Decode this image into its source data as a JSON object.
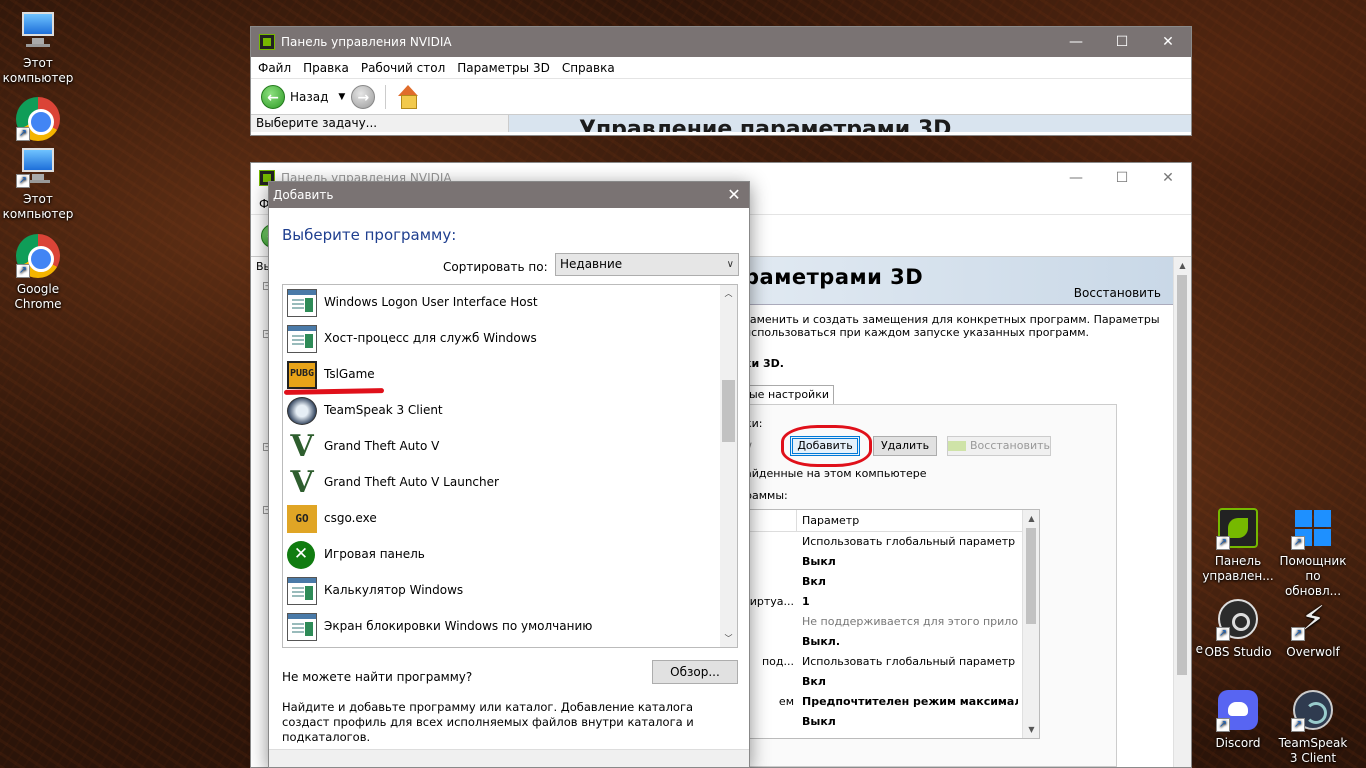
{
  "desktop": {
    "left_icons": [
      {
        "label": "Этот компьютер",
        "icon": "this-pc-icon"
      },
      {
        "label": "",
        "icon": "chrome-icon"
      },
      {
        "label": "Этот компьютер",
        "icon": "this-pc-icon"
      },
      {
        "label": "Google Chrome",
        "icon": "chrome-icon"
      }
    ],
    "right_icons": [
      {
        "label": "Панель управлен...",
        "icon": "nvidia-control-panel-icon"
      },
      {
        "label": "Помощник по обновл...",
        "icon": "windows-update-assistant-icon"
      },
      {
        "label": "OBS Studio",
        "icon": "obs-studio-icon"
      },
      {
        "label": "Overwolf",
        "icon": "overwolf-icon"
      },
      {
        "label": "Discord",
        "icon": "discord-icon"
      },
      {
        "label": "TeamSpeak 3 Client",
        "icon": "teamspeak-icon"
      }
    ],
    "edge_fragment": "e"
  },
  "nvidia_window_top": {
    "title": "Панель управления NVIDIA",
    "menu": [
      "Файл",
      "Правка",
      "Рабочий стол",
      "Параметры 3D",
      "Справка"
    ],
    "back_label": "Назад",
    "task_prompt": "Выберите задачу...",
    "page_title_fragment": "Управление параметрами 3D"
  },
  "nvidia_window_second": {
    "title": "Панель управления NVIDIA",
    "menu_fragment": "Ф",
    "left_fragment": "Вы",
    "banner_title_fragment": "раметрами 3D",
    "restore_link": "Восстановить",
    "description_fragment": "заменить и создать замещения для конкретных программ. Параметры использоваться при каждом запуске указанных программ.",
    "section_fragment": "ки 3D.",
    "tab_fragment": "ые настройки",
    "select_label_fragment": "ки:",
    "add_button": "Добавить",
    "remove_button": "Удалить",
    "restore_button": "Восстановить",
    "found_text_fragment": "айденные на этом компьютере",
    "programs_label_fragment": "раммы:",
    "table_header": "Параметр",
    "rows": [
      {
        "feature": "",
        "value": "Использовать глобальный параметр (Все)",
        "style": "normal"
      },
      {
        "feature": "",
        "value": "Выкл",
        "style": "bold"
      },
      {
        "feature": "",
        "value": "Вкл",
        "style": "bold"
      },
      {
        "feature": "иртуа...",
        "value": "1",
        "style": "bold"
      },
      {
        "feature": "",
        "value": "Не поддерживается для этого приложе...",
        "style": "gray"
      },
      {
        "feature": "",
        "value": "Выкл.",
        "style": "bold"
      },
      {
        "feature": "под...",
        "value": "Использовать глобальный параметр (И...",
        "style": "normal"
      },
      {
        "feature": "",
        "value": "Вкл",
        "style": "bold"
      },
      {
        "feature": "ем",
        "value": "Предпочтителен режим максимал...",
        "style": "bold"
      },
      {
        "feature": "",
        "value": "Выкл",
        "style": "bold"
      }
    ]
  },
  "add_dialog": {
    "title": "Добавить",
    "heading": "Выберите программу:",
    "sort_label": "Сортировать по:",
    "sort_value": "Недавние",
    "programs": [
      {
        "name": "Windows Logon User Interface Host",
        "icon": "window-app-icon"
      },
      {
        "name": "Хост-процесс для служб Windows",
        "icon": "window-app-icon"
      },
      {
        "name": "TslGame",
        "icon": "pubg-icon"
      },
      {
        "name": "TeamSpeak 3 Client",
        "icon": "teamspeak-icon"
      },
      {
        "name": "Grand Theft Auto V",
        "icon": "gta-v-icon"
      },
      {
        "name": "Grand Theft Auto V Launcher",
        "icon": "gta-v-icon"
      },
      {
        "name": "csgo.exe",
        "icon": "csgo-icon"
      },
      {
        "name": "Игровая панель",
        "icon": "xbox-icon"
      },
      {
        "name": "Калькулятор Windows",
        "icon": "window-app-icon"
      },
      {
        "name": "Экран блокировки Windows по умолчанию",
        "icon": "window-app-icon"
      }
    ],
    "cant_find": "Не можете найти программу?",
    "browse_button": "Обзор...",
    "help_text": "Найдите и добавьте программу или каталог. Добавление каталога создаст профиль для всех исполняемых файлов внутри каталога и подкаталогов.",
    "pubg_icon_text": "PUBG",
    "csgo_icon_text": "GO",
    "gta_icon_text": "V"
  },
  "annotation_color": "#e0101a"
}
